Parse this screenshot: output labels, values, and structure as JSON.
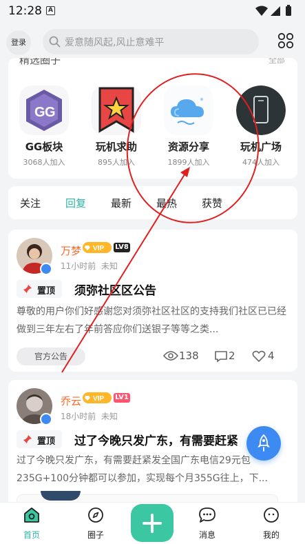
{
  "status": {
    "time": "12:28",
    "notif_letter": "A"
  },
  "header": {
    "login_label": "登录",
    "search_placeholder": "爱意随风起,风止意难平"
  },
  "circles": {
    "title": "精选圈子",
    "more": "全部",
    "items": [
      {
        "name": "GG板块",
        "joined": "3068人加入",
        "icon": "gg-icon"
      },
      {
        "name": "玩机求助",
        "joined": "895人加入",
        "icon": "star-bookmark-icon"
      },
      {
        "name": "资源分享",
        "joined": "1899人加入",
        "icon": "cloud-icon"
      },
      {
        "name": "玩机广场",
        "joined": "474人加入",
        "icon": "phone-icon"
      }
    ]
  },
  "tabs": [
    {
      "label": "关注"
    },
    {
      "label": "回复",
      "active": true
    },
    {
      "label": "最新"
    },
    {
      "label": "最热"
    },
    {
      "label": "获赞"
    }
  ],
  "posts": [
    {
      "user": "万梦",
      "level": "LV8",
      "time": "11小时前",
      "location": "未知",
      "pinned_label": "置顶",
      "title": "须弥社区区公告",
      "body": "尊敬的用户你们好感谢您对须弥社区社区的支持我们社区已已经做到三年左右了年前答应你们送银子等等之类...",
      "tag": "官方公告",
      "views": "138",
      "comments": "2",
      "likes": "4"
    },
    {
      "user": "乔云",
      "level": "LV1",
      "time": "18小时前",
      "location": "未知",
      "pinned_label": "置顶",
      "title": "过了今晚只发广东，有需要赶紧",
      "body": "过了今晚只发广东，有需要赶紧发全国广东电信29元包235G+100分钟都可以参加，实现每个月355G往上，下..."
    }
  ],
  "vip_label": "VIP",
  "bottom_nav": [
    {
      "label": "首页",
      "active": true
    },
    {
      "label": "圈子"
    },
    {
      "label": "消息"
    },
    {
      "label": "我的"
    }
  ],
  "colors": {
    "accent": "#2bb5a6",
    "username": "#ff6a2b",
    "annotation": "#e0201f",
    "plus": "#3cc7a3"
  }
}
